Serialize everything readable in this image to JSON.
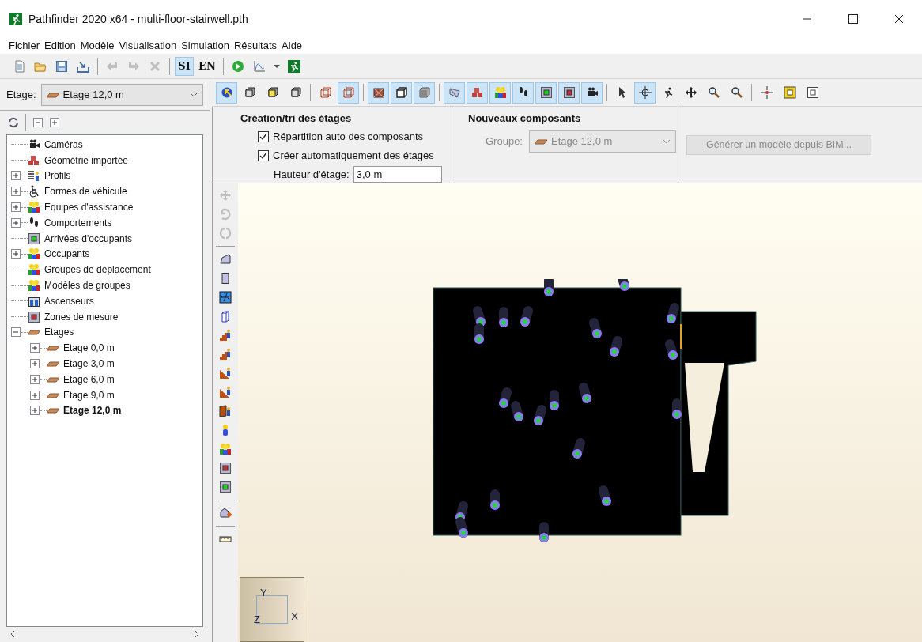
{
  "window": {
    "title": "Pathfinder 2020 x64 - multi-floor-stairwell.pth"
  },
  "menu": [
    "Fichier",
    "Edition",
    "Modèle",
    "Visualisation",
    "Simulation",
    "Résultats",
    "Aide"
  ],
  "main_toolbar": [
    {
      "kind": "new",
      "selected": false,
      "disabled": false
    },
    {
      "kind": "open",
      "selected": false,
      "disabled": false
    },
    {
      "kind": "save",
      "selected": false,
      "disabled": false
    },
    {
      "kind": "import",
      "selected": false,
      "disabled": false
    },
    {
      "kind": "separator"
    },
    {
      "kind": "undo",
      "selected": false,
      "disabled": true
    },
    {
      "kind": "redo",
      "selected": false,
      "disabled": true
    },
    {
      "kind": "delete",
      "selected": false,
      "disabled": true
    },
    {
      "kind": "separator"
    },
    {
      "kind": "text",
      "label": "SI",
      "selected": true,
      "disabled": false
    },
    {
      "kind": "text",
      "label": "EN",
      "selected": false,
      "disabled": false
    },
    {
      "kind": "separator"
    },
    {
      "kind": "run",
      "selected": false,
      "disabled": false
    },
    {
      "kind": "chart",
      "selected": false,
      "disabled": false
    },
    {
      "kind": "caret",
      "selected": false,
      "disabled": false
    },
    {
      "kind": "runner",
      "selected": false,
      "disabled": false
    }
  ],
  "floor_selector": {
    "label": "Etage:",
    "value": "Etage 12,0 m"
  },
  "tree_toolbar": [
    {
      "kind": "sync"
    },
    {
      "kind": "separator"
    },
    {
      "kind": "collapse"
    },
    {
      "kind": "expand"
    }
  ],
  "tree": [
    {
      "label": "Caméras",
      "kind": "camera",
      "active": false
    },
    {
      "label": "Géométrie importée",
      "kind": "bricks",
      "active": false
    },
    {
      "label": "Profils",
      "kind": "profile",
      "expanded": false,
      "active": false
    },
    {
      "label": "Formes de véhicule",
      "kind": "wheelchair",
      "expanded": false,
      "active": false
    },
    {
      "label": "Equipes d'assistance",
      "kind": "people",
      "expanded": false,
      "active": false
    },
    {
      "label": "Comportements",
      "kind": "footprints",
      "expanded": false,
      "active": false
    },
    {
      "label": "Arrivées d'occupants",
      "kind": "green-room",
      "active": false
    },
    {
      "label": "Occupants",
      "kind": "people",
      "expanded": false,
      "active": false
    },
    {
      "label": "Groupes de déplacement",
      "kind": "people",
      "active": false
    },
    {
      "label": "Modèles de groupes",
      "kind": "people",
      "active": false
    },
    {
      "label": "Ascenseurs",
      "kind": "elevator",
      "active": false
    },
    {
      "label": "Zones de mesure",
      "kind": "red-room",
      "active": false
    },
    {
      "label": "Etages",
      "kind": "floor",
      "expanded": true,
      "active": false,
      "children": [
        {
          "label": "Etage 0,0 m",
          "kind": "floor",
          "expanded": false,
          "active": false
        },
        {
          "label": "Etage 3,0 m",
          "kind": "floor",
          "expanded": false,
          "active": false
        },
        {
          "label": "Etage 6,0 m",
          "kind": "floor",
          "expanded": false,
          "active": false
        },
        {
          "label": "Etage 9,0 m",
          "kind": "floor",
          "expanded": false,
          "active": false
        },
        {
          "label": "Etage 12,0 m",
          "kind": "floor",
          "expanded": false,
          "active": true
        }
      ]
    }
  ],
  "view_toolbar": [
    {
      "kind": "ball",
      "selected": true
    },
    {
      "kind": "cube",
      "selected": false
    },
    {
      "kind": "cube-yellow",
      "selected": false
    },
    {
      "kind": "cube",
      "selected": false
    },
    {
      "kind": "separator"
    },
    {
      "kind": "wire-cube",
      "selected": false
    },
    {
      "kind": "wire-cube",
      "selected": true
    },
    {
      "kind": "separator"
    },
    {
      "kind": "brick-cube",
      "selected": true
    },
    {
      "kind": "dark-cube",
      "selected": true
    },
    {
      "kind": "grey-cube",
      "selected": true
    },
    {
      "kind": "separator"
    },
    {
      "kind": "fly",
      "selected": true
    },
    {
      "kind": "bricks",
      "selected": true
    },
    {
      "kind": "people",
      "selected": true
    },
    {
      "kind": "footprints",
      "selected": true
    },
    {
      "kind": "green-room",
      "selected": true
    },
    {
      "kind": "red-room",
      "selected": true
    },
    {
      "kind": "camera",
      "selected": true
    },
    {
      "kind": "separator"
    },
    {
      "kind": "pointer",
      "selected": false
    },
    {
      "kind": "orbit",
      "selected": true
    },
    {
      "kind": "runner-black",
      "selected": false
    },
    {
      "kind": "move",
      "selected": false
    },
    {
      "kind": "zoom",
      "selected": false
    },
    {
      "kind": "zoom",
      "selected": false
    },
    {
      "kind": "separator"
    },
    {
      "kind": "crosshair",
      "selected": false
    },
    {
      "kind": "fit",
      "selected": false
    },
    {
      "kind": "fit-outline",
      "selected": false
    }
  ],
  "properties": {
    "floors": {
      "title": "Création/tri des étages",
      "checks": [
        {
          "label": "Répartition auto des composants",
          "checked": true
        },
        {
          "label": "Créer automatiquement des étages",
          "checked": true
        }
      ],
      "height_label": "Hauteur d'étage:",
      "height_value": "3,0 m"
    },
    "components": {
      "title": "Nouveaux composants",
      "group_label": "Groupe:",
      "group_value": "Etage 12,0 m",
      "disabled": true
    },
    "bim_button": {
      "label": "Générer un modèle depuis BIM...",
      "disabled": true
    }
  },
  "side_toolbar": [
    {
      "kind": "move",
      "disabled": true
    },
    {
      "kind": "rotate",
      "disabled": true
    },
    {
      "kind": "mirror",
      "disabled": true
    },
    {
      "kind": "separator"
    },
    {
      "kind": "polygon",
      "disabled": false
    },
    {
      "kind": "rect",
      "disabled": false
    },
    {
      "kind": "door",
      "disabled": false
    },
    {
      "kind": "wall",
      "disabled": false
    },
    {
      "kind": "stair1",
      "disabled": false
    },
    {
      "kind": "stair2",
      "disabled": false
    },
    {
      "kind": "ramp1",
      "disabled": false
    },
    {
      "kind": "ramp2",
      "disabled": false
    },
    {
      "kind": "exit-door",
      "disabled": false
    },
    {
      "kind": "person",
      "disabled": false
    },
    {
      "kind": "people",
      "disabled": false
    },
    {
      "kind": "red-room",
      "disabled": false
    },
    {
      "kind": "green-room",
      "disabled": false
    },
    {
      "kind": "separator"
    },
    {
      "kind": "shape-arrow",
      "disabled": false
    },
    {
      "kind": "separator"
    },
    {
      "kind": "ruler",
      "disabled": false
    }
  ],
  "axes": {
    "x": "X",
    "y": "Y",
    "z": "Z"
  }
}
